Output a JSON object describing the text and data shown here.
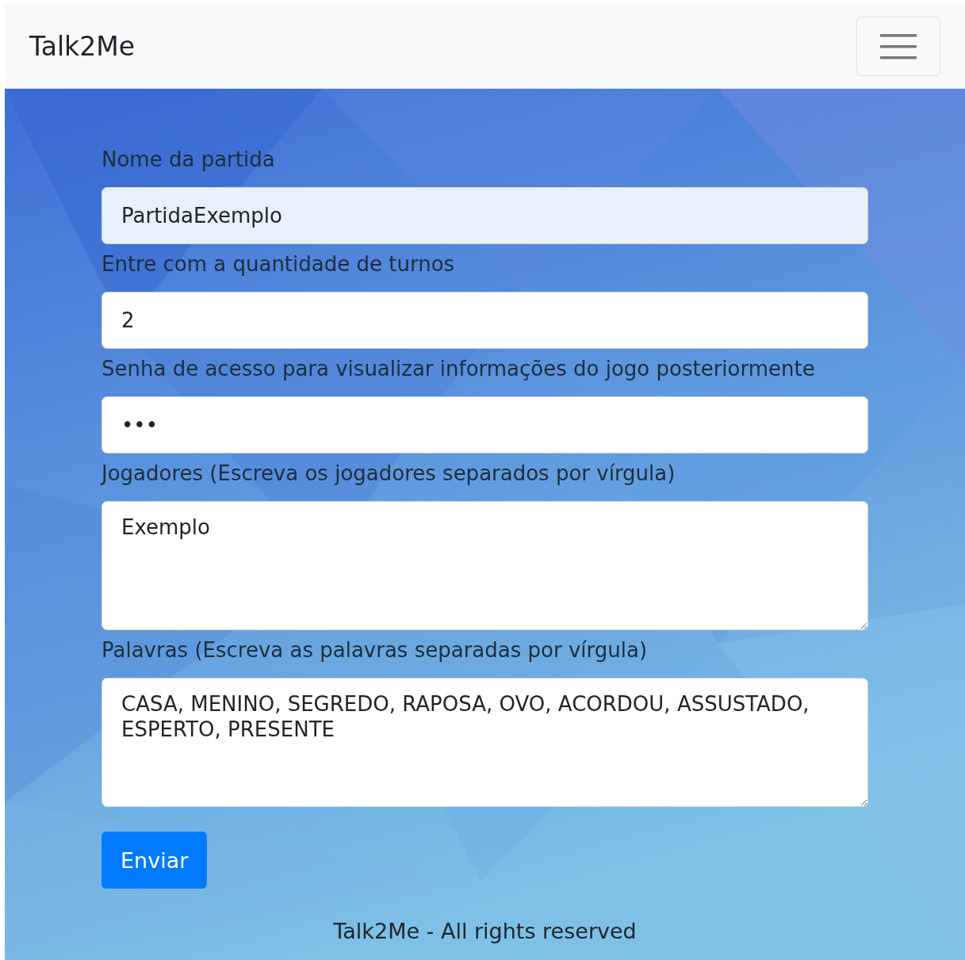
{
  "navbar": {
    "brand": "Talk2Me"
  },
  "fields": [
    {
      "kind": "input",
      "label": "Nome da partida",
      "value": "PartidaExemplo",
      "autofilled": true
    },
    {
      "kind": "input",
      "label": "Entre com a quantidade de turnos",
      "value": "2",
      "autofilled": false
    },
    {
      "kind": "input",
      "label": "Senha de acesso para visualizar informações do jogo posteriormente",
      "value": "•••",
      "autofilled": false
    },
    {
      "kind": "textarea",
      "label": "Jogadores (Escreva os jogadores separados por vírgula)",
      "value": "Exemplo"
    },
    {
      "kind": "textarea",
      "label": "Palavras (Escreva as palavras separadas por vírgula)",
      "value": "CASA, MENINO, SEGREDO, RAPOSA, OVO, ACORDOU, ASSUSTADO, ESPERTO, PRESENTE"
    }
  ],
  "submit_button": "Enviar",
  "footer": "Talk2Me - All rights reserved"
}
